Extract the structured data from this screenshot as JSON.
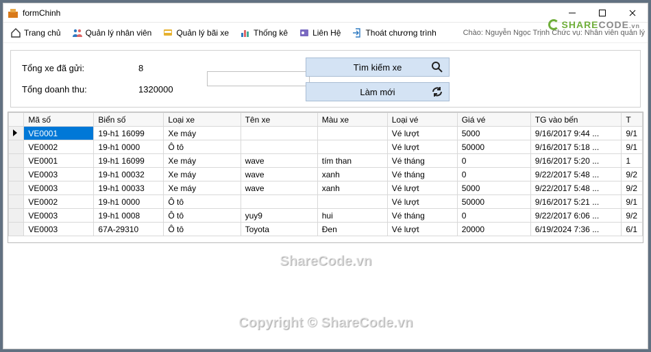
{
  "window": {
    "title": "formChinh"
  },
  "toolbar": {
    "home": "Trang chủ",
    "staff": "Quản lý nhân viên",
    "parking": "Quản lý bãi xe",
    "stats": "Thống kê",
    "contact": "Liên Hệ",
    "exit": "Thoát chương trình",
    "greeting": "Chào: Nguyễn Ngọc Trịnh Chức vụ: Nhân viên quản lý"
  },
  "summary": {
    "total_sent_label": "Tổng xe đã gửi:",
    "total_sent_value": "8",
    "revenue_label": "Tổng doanh thu:",
    "revenue_value": "1320000",
    "search_btn": "Tìm kiếm xe",
    "refresh_btn": "Làm mới"
  },
  "grid": {
    "columns": [
      "Mã số",
      "Biển số",
      "Loại xe",
      "Tên xe",
      "Màu xe",
      "Loại vé",
      "Giá vé",
      "TG vào bến",
      "T"
    ],
    "rows": [
      {
        "ma": "VE0001",
        "bien": "19-h1 16099",
        "loaixe": "Xe máy",
        "ten": "",
        "mau": "",
        "loaive": "Vé lượt",
        "gia": "5000",
        "tg": "9/16/2017 9:44 ...",
        "tg2": "9/1"
      },
      {
        "ma": "VE0002",
        "bien": "19-h1 0000",
        "loaixe": "Ô tô",
        "ten": "",
        "mau": "",
        "loaive": "Vé lượt",
        "gia": "50000",
        "tg": "9/16/2017 5:18 ...",
        "tg2": "9/1"
      },
      {
        "ma": "VE0001",
        "bien": "19-h1 16099",
        "loaixe": "Xe máy",
        "ten": "wave",
        "mau": "tím than",
        "loaive": "Vé tháng",
        "gia": "0",
        "tg": "9/16/2017 5:20 ...",
        "tg2": "1"
      },
      {
        "ma": "VE0003",
        "bien": "19-h1 00032",
        "loaixe": "Xe máy",
        "ten": "wave",
        "mau": "xanh",
        "loaive": "Vé tháng",
        "gia": "0",
        "tg": "9/22/2017 5:48 ...",
        "tg2": "9/2"
      },
      {
        "ma": "VE0003",
        "bien": "19-h1 00033",
        "loaixe": "Xe máy",
        "ten": "wave",
        "mau": "xanh",
        "loaive": "Vé lượt",
        "gia": "5000",
        "tg": "9/22/2017 5:48 ...",
        "tg2": "9/2"
      },
      {
        "ma": "VE0002",
        "bien": "19-h1 0000",
        "loaixe": "Ô tô",
        "ten": "",
        "mau": "",
        "loaive": "Vé lượt",
        "gia": "50000",
        "tg": "9/16/2017 5:21 ...",
        "tg2": "9/1"
      },
      {
        "ma": "VE0003",
        "bien": "19-h1 0008",
        "loaixe": "Ô tô",
        "ten": "yuy9",
        "mau": "hui",
        "loaive": "Vé tháng",
        "gia": "0",
        "tg": "9/22/2017 6:06 ...",
        "tg2": "9/2"
      },
      {
        "ma": "VE0003",
        "bien": "67A-29310",
        "loaixe": "Ô tô",
        "ten": "Toyota",
        "mau": "Đen",
        "loaive": "Vé lượt",
        "gia": "20000",
        "tg": "6/19/2024 7:36 ...",
        "tg2": "6/1"
      }
    ]
  },
  "watermark": {
    "text1": "ShareCode.vn",
    "text2": "Copyright © ShareCode.vn"
  },
  "logo": {
    "text_a": "SHARE",
    "text_b": "CODE",
    "suffix": ".vn"
  }
}
